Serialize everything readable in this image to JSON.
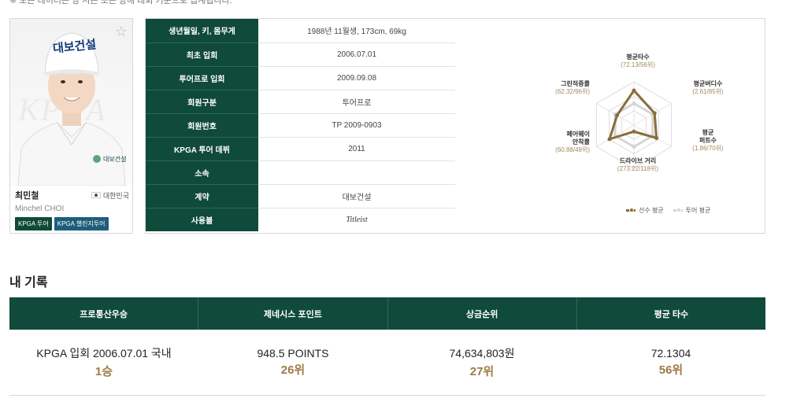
{
  "top_notice": "※ 모든 데이터는 당 시즌 또는 당해 대회 기준으로 집계됩니다.",
  "player": {
    "name_kr": "최민철",
    "name_en": "Minchel CHOI",
    "country": "대한민국",
    "cap_text": "대보건설",
    "watermark": "KPGA",
    "badges": [
      "KPGA 투어",
      "KPGA 챌린지투어"
    ]
  },
  "info_table": [
    {
      "label": "생년월일, 키, 몸무게",
      "value": "1988년 11월생, 173cm, 69kg"
    },
    {
      "label": "최초 입회",
      "value": "2006.07.01"
    },
    {
      "label": "투어프로 입회",
      "value": "2009.09.08"
    },
    {
      "label": "회원구분",
      "value": "투어프로"
    },
    {
      "label": "회원번호",
      "value": "TP 2009-0903"
    },
    {
      "label": "KPGA 투어 데뷔",
      "value": "2011"
    },
    {
      "label": "소속",
      "value": ""
    },
    {
      "label": "계약",
      "value": "대보건설"
    },
    {
      "label": "사용볼",
      "value": "Titleist"
    }
  ],
  "radar": {
    "axes": [
      {
        "title": "평균타수",
        "value": "(72.13/56위)"
      },
      {
        "title": "평균버디수",
        "value": "(2.61/85위)"
      },
      {
        "title": "평균",
        "title2": "퍼트수",
        "value": "(1.86/70위)"
      },
      {
        "title": "드라이브 거리",
        "value": "(273.22/118위)"
      },
      {
        "title": "페어웨이",
        "title2": "안착률",
        "value": "(60.88/49위)"
      },
      {
        "title": "그린적중률",
        "value": "(62.32/96위)"
      }
    ],
    "player_values": [
      0.8,
      0.55,
      0.6,
      0.15,
      0.65,
      0.45
    ],
    "tour_values": [
      0.5,
      0.5,
      0.5,
      0.5,
      0.5,
      0.5
    ],
    "legend_player": "선수 평균",
    "legend_tour": "투어 평균",
    "color_player": "#8a6d3b",
    "color_tour": "#d5d5d5"
  },
  "records": {
    "title": "내 기록",
    "headers": [
      "프로통산우승",
      "제네시스 포인트",
      "상금순위",
      "평균 타수"
    ],
    "cells": [
      {
        "main": "KPGA 입회 2006.07.01 국내",
        "sub": "1승"
      },
      {
        "main": "948.5 POINTS",
        "sub": "26위"
      },
      {
        "main": "74,634,803원",
        "sub": "27위"
      },
      {
        "main": "72.1304",
        "sub": "56위"
      }
    ]
  }
}
